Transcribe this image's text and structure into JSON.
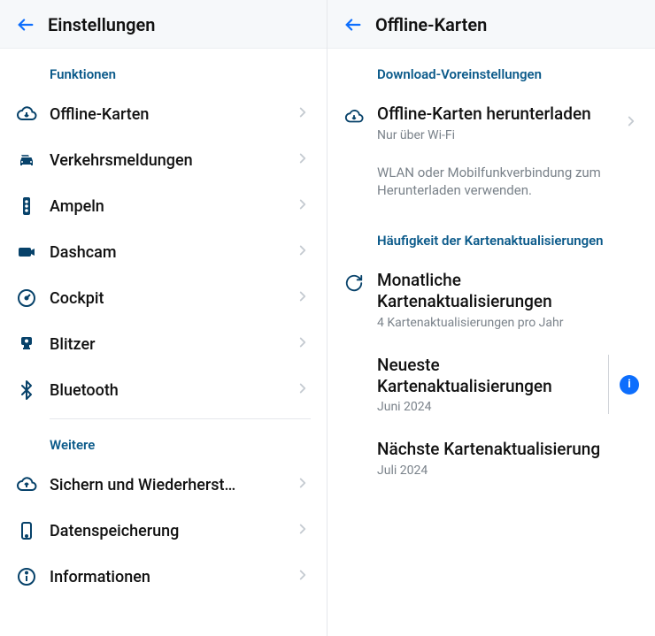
{
  "left": {
    "title": "Einstellungen",
    "sections": {
      "funktionen": {
        "header": "Funktionen",
        "items": [
          {
            "label": "Offline-Karten"
          },
          {
            "label": "Verkehrsmeldungen"
          },
          {
            "label": "Ampeln"
          },
          {
            "label": "Dashcam"
          },
          {
            "label": "Cockpit"
          },
          {
            "label": "Blitzer"
          },
          {
            "label": "Bluetooth"
          }
        ]
      },
      "weitere": {
        "header": "Weitere",
        "items": [
          {
            "label": "Sichern und Wiederherst…"
          },
          {
            "label": "Datenspeicherung"
          },
          {
            "label": "Informationen"
          }
        ]
      }
    }
  },
  "right": {
    "title": "Offline-Karten",
    "download_section": {
      "header": "Download-Voreinstellungen",
      "item": {
        "title": "Offline-Karten herunterladen",
        "subtitle": "Nur über Wi-Fi"
      },
      "hint": "WLAN oder Mobilfunkverbindung zum Herunterladen verwenden."
    },
    "update_section": {
      "header": "Häufigkeit der Kartenaktualisierungen",
      "monthly": {
        "title": "Monatliche Kartenaktualisierungen",
        "subtitle": "4 Kartenaktualisierungen pro Jahr"
      },
      "latest": {
        "title": "Neueste Kartenaktualisierungen",
        "date": "Juni 2024"
      },
      "next": {
        "title": "Nächste Kartenaktualisierung",
        "date": "Juli 2024"
      }
    }
  }
}
